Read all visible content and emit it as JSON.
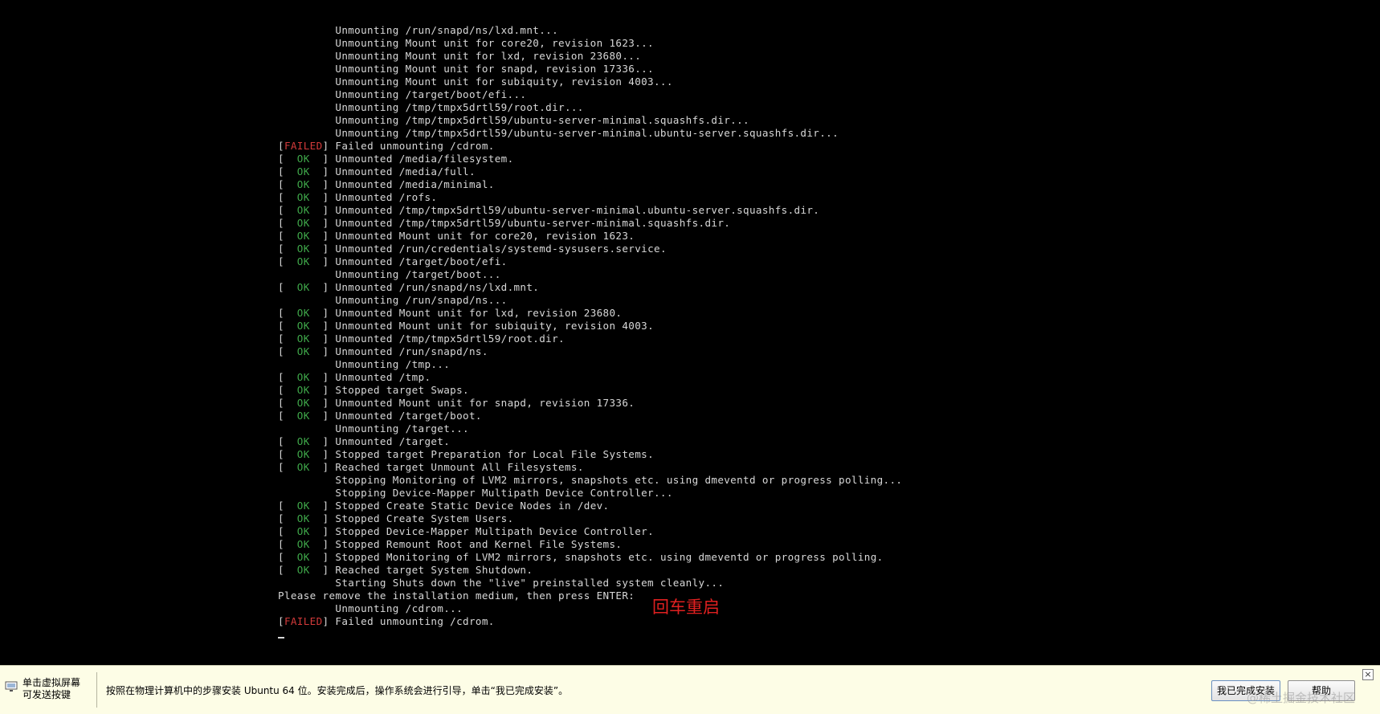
{
  "console": {
    "lines": [
      {
        "tag": "",
        "text": "Unmounting /run/snapd/ns/lxd.mnt..."
      },
      {
        "tag": "",
        "text": "Unmounting Mount unit for core20, revision 1623..."
      },
      {
        "tag": "",
        "text": "Unmounting Mount unit for lxd, revision 23680..."
      },
      {
        "tag": "",
        "text": "Unmounting Mount unit for snapd, revision 17336..."
      },
      {
        "tag": "",
        "text": "Unmounting Mount unit for subiquity, revision 4003..."
      },
      {
        "tag": "",
        "text": "Unmounting /target/boot/efi..."
      },
      {
        "tag": "",
        "text": "Unmounting /tmp/tmpx5drtl59/root.dir..."
      },
      {
        "tag": "",
        "text": "Unmounting /tmp/tmpx5drtl59/ubuntu-server-minimal.squashfs.dir..."
      },
      {
        "tag": "",
        "text": "Unmounting /tmp/tmpx5drtl59/ubuntu-server-minimal.ubuntu-server.squashfs.dir..."
      },
      {
        "tag": "FAILED",
        "text": "Failed unmounting /cdrom."
      },
      {
        "tag": "OK",
        "text": "Unmounted /media/filesystem."
      },
      {
        "tag": "OK",
        "text": "Unmounted /media/full."
      },
      {
        "tag": "OK",
        "text": "Unmounted /media/minimal."
      },
      {
        "tag": "OK",
        "text": "Unmounted /rofs."
      },
      {
        "tag": "OK",
        "text": "Unmounted /tmp/tmpx5drtl59/ubuntu-server-minimal.ubuntu-server.squashfs.dir."
      },
      {
        "tag": "OK",
        "text": "Unmounted /tmp/tmpx5drtl59/ubuntu-server-minimal.squashfs.dir."
      },
      {
        "tag": "OK",
        "text": "Unmounted Mount unit for core20, revision 1623."
      },
      {
        "tag": "OK",
        "text": "Unmounted /run/credentials/systemd-sysusers.service."
      },
      {
        "tag": "OK",
        "text": "Unmounted /target/boot/efi."
      },
      {
        "tag": "",
        "text": "Unmounting /target/boot..."
      },
      {
        "tag": "OK",
        "text": "Unmounted /run/snapd/ns/lxd.mnt."
      },
      {
        "tag": "",
        "text": "Unmounting /run/snapd/ns..."
      },
      {
        "tag": "OK",
        "text": "Unmounted Mount unit for lxd, revision 23680."
      },
      {
        "tag": "OK",
        "text": "Unmounted Mount unit for subiquity, revision 4003."
      },
      {
        "tag": "OK",
        "text": "Unmounted /tmp/tmpx5drtl59/root.dir."
      },
      {
        "tag": "OK",
        "text": "Unmounted /run/snapd/ns."
      },
      {
        "tag": "",
        "text": "Unmounting /tmp..."
      },
      {
        "tag": "OK",
        "text": "Unmounted /tmp."
      },
      {
        "tag": "OK",
        "text": "Stopped target Swaps."
      },
      {
        "tag": "OK",
        "text": "Unmounted Mount unit for snapd, revision 17336."
      },
      {
        "tag": "OK",
        "text": "Unmounted /target/boot."
      },
      {
        "tag": "",
        "text": "Unmounting /target..."
      },
      {
        "tag": "OK",
        "text": "Unmounted /target."
      },
      {
        "tag": "OK",
        "text": "Stopped target Preparation for Local File Systems."
      },
      {
        "tag": "OK",
        "text": "Reached target Unmount All Filesystems."
      },
      {
        "tag": "",
        "text": "Stopping Monitoring of LVM2 mirrors, snapshots etc. using dmeventd or progress polling..."
      },
      {
        "tag": "",
        "text": "Stopping Device-Mapper Multipath Device Controller..."
      },
      {
        "tag": "OK",
        "text": "Stopped Create Static Device Nodes in /dev."
      },
      {
        "tag": "OK",
        "text": "Stopped Create System Users."
      },
      {
        "tag": "OK",
        "text": "Stopped Device-Mapper Multipath Device Controller."
      },
      {
        "tag": "OK",
        "text": "Stopped Remount Root and Kernel File Systems."
      },
      {
        "tag": "OK",
        "text": "Stopped Monitoring of LVM2 mirrors, snapshots etc. using dmeventd or progress polling."
      },
      {
        "tag": "OK",
        "text": "Reached target System Shutdown."
      },
      {
        "tag": "",
        "text": "Starting Shuts down the \"live\" preinstalled system cleanly..."
      },
      {
        "tag": "PLAIN",
        "text": "Please remove the installation medium, then press ENTER:"
      },
      {
        "tag": "",
        "text": "Unmounting /cdrom..."
      },
      {
        "tag": "FAILED",
        "text": "Failed unmounting /cdrom."
      }
    ]
  },
  "annotation": {
    "text": "回车重启",
    "color": "#e02020"
  },
  "hint_bar": {
    "screen_hint_line1": "单击虚拟屏幕",
    "screen_hint_line2": "可发送按键",
    "main_hint": "按照在物理计算机中的步骤安装 Ubuntu 64 位。安装完成后，操作系统会进行引导，单击“我已完成安装”。",
    "done_button": "我已完成安装",
    "help_button": "帮助",
    "close_symbol": "×"
  },
  "watermark": "@稀土掘金技术社区",
  "colors": {
    "ok": "#3fa84a",
    "failed": "#d23a3a",
    "text": "#d8d8d8",
    "background": "#000000"
  }
}
